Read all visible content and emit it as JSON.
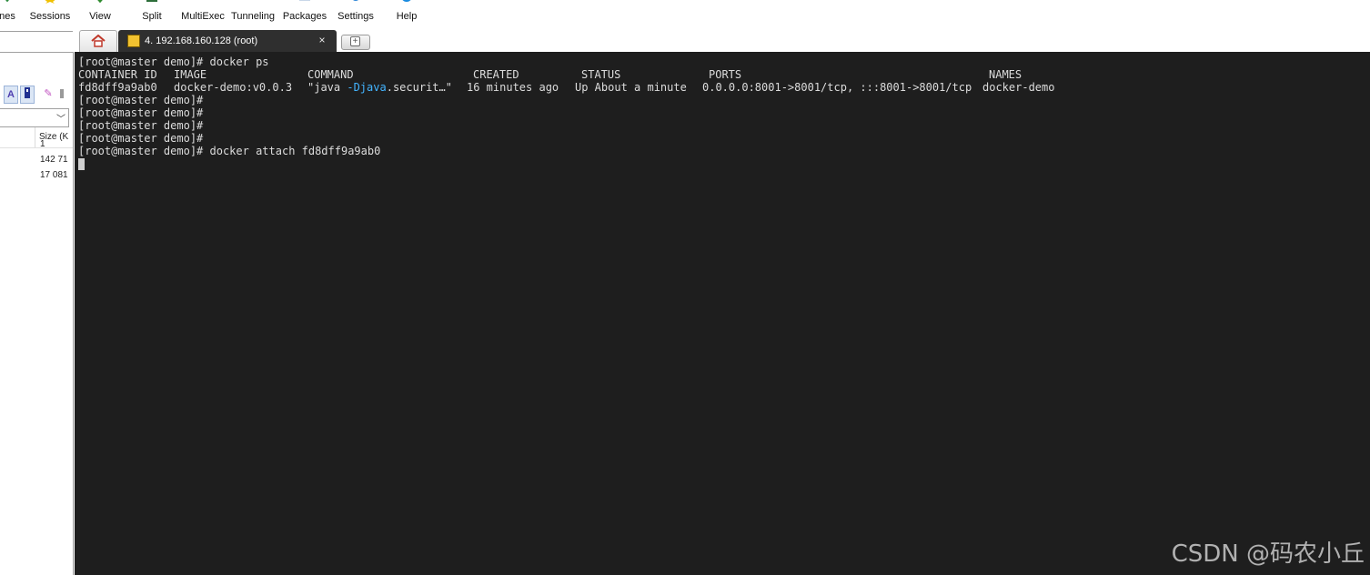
{
  "toolbar": {
    "items": [
      {
        "label": "nes",
        "icon": "sessions-icon"
      },
      {
        "label": "Sessions",
        "icon": "star-icon"
      },
      {
        "label": "View",
        "icon": "view-icon"
      },
      {
        "label": "Split",
        "icon": "split-icon"
      },
      {
        "label": "MultiExec",
        "icon": "multiexec-icon"
      },
      {
        "label": "Tunneling",
        "icon": "tunneling-icon"
      },
      {
        "label": "Packages",
        "icon": "packages-icon"
      },
      {
        "label": "Settings",
        "icon": "gear-icon"
      },
      {
        "label": "Help",
        "icon": "help-icon"
      }
    ]
  },
  "left_panel": {
    "search_value": "",
    "column_header": "Size (K",
    "sizes": [
      "1",
      "142 71",
      "17 081"
    ]
  },
  "tabs": {
    "home_icon": "home-icon",
    "active_title": "4. 192.168.160.128 (root)",
    "close_label": "×"
  },
  "terminal": {
    "lines": [
      "[root@master demo]# docker ps",
      "",
      "",
      "[root@master demo]#",
      "[root@master demo]#",
      "[root@master demo]#",
      "[root@master demo]#",
      "[root@master demo]# docker attach fd8dff9a9ab0"
    ],
    "ps_headers": [
      "CONTAINER ID",
      "IMAGE",
      "COMMAND",
      "CREATED",
      "STATUS",
      "PORTS",
      "NAMES"
    ],
    "ps_row": {
      "container_id": "fd8dff9a9ab0",
      "image": "docker-demo:v0.0.3",
      "command_prefix": "\"java ",
      "command_highlight": "-Djava",
      "command_suffix": ".securit…\"",
      "created": "16 minutes ago",
      "status": "Up About a minute",
      "ports": "0.0.0.0:8001->8001/tcp, :::8001->8001/tcp",
      "names": "docker-demo"
    },
    "background_color": "#1e1e1e",
    "text_color": "#dcdcdc",
    "highlight_color": "#43b4ff"
  },
  "watermark": "CSDN @码农小丘"
}
